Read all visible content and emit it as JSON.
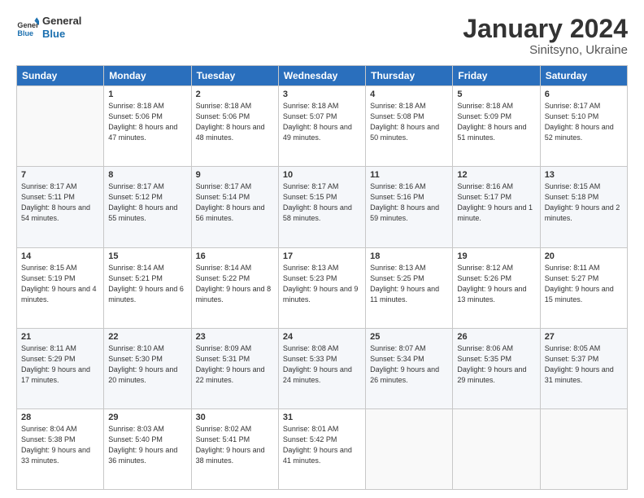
{
  "header": {
    "logo_general": "General",
    "logo_blue": "Blue",
    "main_title": "January 2024",
    "subtitle": "Sinitsyno, Ukraine"
  },
  "columns": [
    "Sunday",
    "Monday",
    "Tuesday",
    "Wednesday",
    "Thursday",
    "Friday",
    "Saturday"
  ],
  "weeks": [
    [
      {
        "day": "",
        "sunrise": "",
        "sunset": "",
        "daylight": ""
      },
      {
        "day": "1",
        "sunrise": "Sunrise: 8:18 AM",
        "sunset": "Sunset: 5:06 PM",
        "daylight": "Daylight: 8 hours and 47 minutes."
      },
      {
        "day": "2",
        "sunrise": "Sunrise: 8:18 AM",
        "sunset": "Sunset: 5:06 PM",
        "daylight": "Daylight: 8 hours and 48 minutes."
      },
      {
        "day": "3",
        "sunrise": "Sunrise: 8:18 AM",
        "sunset": "Sunset: 5:07 PM",
        "daylight": "Daylight: 8 hours and 49 minutes."
      },
      {
        "day": "4",
        "sunrise": "Sunrise: 8:18 AM",
        "sunset": "Sunset: 5:08 PM",
        "daylight": "Daylight: 8 hours and 50 minutes."
      },
      {
        "day": "5",
        "sunrise": "Sunrise: 8:18 AM",
        "sunset": "Sunset: 5:09 PM",
        "daylight": "Daylight: 8 hours and 51 minutes."
      },
      {
        "day": "6",
        "sunrise": "Sunrise: 8:17 AM",
        "sunset": "Sunset: 5:10 PM",
        "daylight": "Daylight: 8 hours and 52 minutes."
      }
    ],
    [
      {
        "day": "7",
        "sunrise": "Sunrise: 8:17 AM",
        "sunset": "Sunset: 5:11 PM",
        "daylight": "Daylight: 8 hours and 54 minutes."
      },
      {
        "day": "8",
        "sunrise": "Sunrise: 8:17 AM",
        "sunset": "Sunset: 5:12 PM",
        "daylight": "Daylight: 8 hours and 55 minutes."
      },
      {
        "day": "9",
        "sunrise": "Sunrise: 8:17 AM",
        "sunset": "Sunset: 5:14 PM",
        "daylight": "Daylight: 8 hours and 56 minutes."
      },
      {
        "day": "10",
        "sunrise": "Sunrise: 8:17 AM",
        "sunset": "Sunset: 5:15 PM",
        "daylight": "Daylight: 8 hours and 58 minutes."
      },
      {
        "day": "11",
        "sunrise": "Sunrise: 8:16 AM",
        "sunset": "Sunset: 5:16 PM",
        "daylight": "Daylight: 8 hours and 59 minutes."
      },
      {
        "day": "12",
        "sunrise": "Sunrise: 8:16 AM",
        "sunset": "Sunset: 5:17 PM",
        "daylight": "Daylight: 9 hours and 1 minute."
      },
      {
        "day": "13",
        "sunrise": "Sunrise: 8:15 AM",
        "sunset": "Sunset: 5:18 PM",
        "daylight": "Daylight: 9 hours and 2 minutes."
      }
    ],
    [
      {
        "day": "14",
        "sunrise": "Sunrise: 8:15 AM",
        "sunset": "Sunset: 5:19 PM",
        "daylight": "Daylight: 9 hours and 4 minutes."
      },
      {
        "day": "15",
        "sunrise": "Sunrise: 8:14 AM",
        "sunset": "Sunset: 5:21 PM",
        "daylight": "Daylight: 9 hours and 6 minutes."
      },
      {
        "day": "16",
        "sunrise": "Sunrise: 8:14 AM",
        "sunset": "Sunset: 5:22 PM",
        "daylight": "Daylight: 9 hours and 8 minutes."
      },
      {
        "day": "17",
        "sunrise": "Sunrise: 8:13 AM",
        "sunset": "Sunset: 5:23 PM",
        "daylight": "Daylight: 9 hours and 9 minutes."
      },
      {
        "day": "18",
        "sunrise": "Sunrise: 8:13 AM",
        "sunset": "Sunset: 5:25 PM",
        "daylight": "Daylight: 9 hours and 11 minutes."
      },
      {
        "day": "19",
        "sunrise": "Sunrise: 8:12 AM",
        "sunset": "Sunset: 5:26 PM",
        "daylight": "Daylight: 9 hours and 13 minutes."
      },
      {
        "day": "20",
        "sunrise": "Sunrise: 8:11 AM",
        "sunset": "Sunset: 5:27 PM",
        "daylight": "Daylight: 9 hours and 15 minutes."
      }
    ],
    [
      {
        "day": "21",
        "sunrise": "Sunrise: 8:11 AM",
        "sunset": "Sunset: 5:29 PM",
        "daylight": "Daylight: 9 hours and 17 minutes."
      },
      {
        "day": "22",
        "sunrise": "Sunrise: 8:10 AM",
        "sunset": "Sunset: 5:30 PM",
        "daylight": "Daylight: 9 hours and 20 minutes."
      },
      {
        "day": "23",
        "sunrise": "Sunrise: 8:09 AM",
        "sunset": "Sunset: 5:31 PM",
        "daylight": "Daylight: 9 hours and 22 minutes."
      },
      {
        "day": "24",
        "sunrise": "Sunrise: 8:08 AM",
        "sunset": "Sunset: 5:33 PM",
        "daylight": "Daylight: 9 hours and 24 minutes."
      },
      {
        "day": "25",
        "sunrise": "Sunrise: 8:07 AM",
        "sunset": "Sunset: 5:34 PM",
        "daylight": "Daylight: 9 hours and 26 minutes."
      },
      {
        "day": "26",
        "sunrise": "Sunrise: 8:06 AM",
        "sunset": "Sunset: 5:35 PM",
        "daylight": "Daylight: 9 hours and 29 minutes."
      },
      {
        "day": "27",
        "sunrise": "Sunrise: 8:05 AM",
        "sunset": "Sunset: 5:37 PM",
        "daylight": "Daylight: 9 hours and 31 minutes."
      }
    ],
    [
      {
        "day": "28",
        "sunrise": "Sunrise: 8:04 AM",
        "sunset": "Sunset: 5:38 PM",
        "daylight": "Daylight: 9 hours and 33 minutes."
      },
      {
        "day": "29",
        "sunrise": "Sunrise: 8:03 AM",
        "sunset": "Sunset: 5:40 PM",
        "daylight": "Daylight: 9 hours and 36 minutes."
      },
      {
        "day": "30",
        "sunrise": "Sunrise: 8:02 AM",
        "sunset": "Sunset: 5:41 PM",
        "daylight": "Daylight: 9 hours and 38 minutes."
      },
      {
        "day": "31",
        "sunrise": "Sunrise: 8:01 AM",
        "sunset": "Sunset: 5:42 PM",
        "daylight": "Daylight: 9 hours and 41 minutes."
      },
      {
        "day": "",
        "sunrise": "",
        "sunset": "",
        "daylight": ""
      },
      {
        "day": "",
        "sunrise": "",
        "sunset": "",
        "daylight": ""
      },
      {
        "day": "",
        "sunrise": "",
        "sunset": "",
        "daylight": ""
      }
    ]
  ]
}
